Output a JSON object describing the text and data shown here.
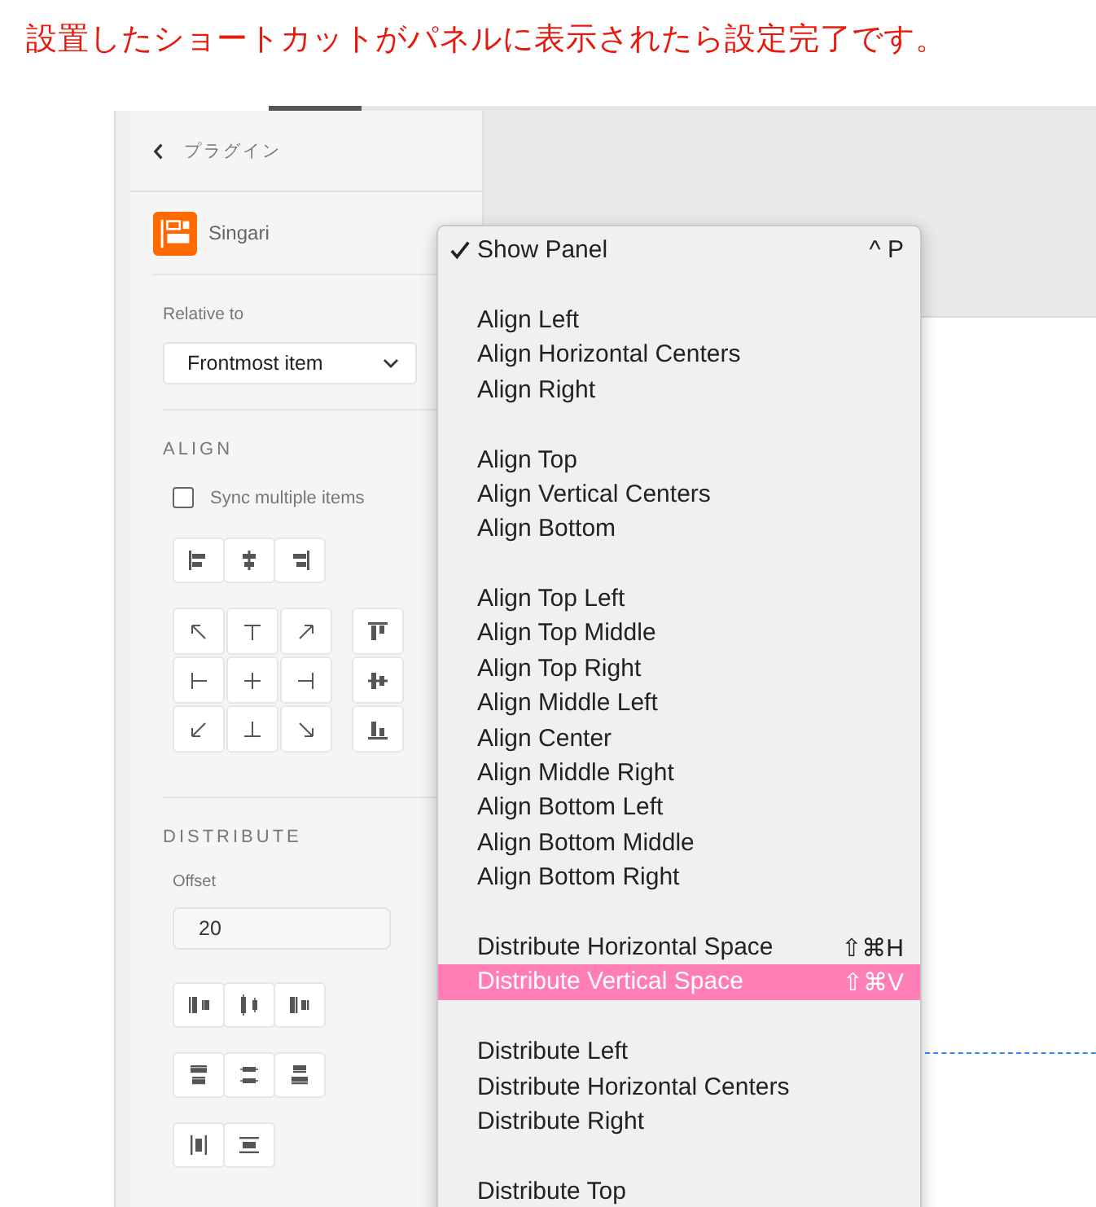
{
  "caption": "設置したショートカットがパネルに表示されたら設定完了です。",
  "panel": {
    "back_label": "プラグイン",
    "plugin_name": "Singari",
    "relative_label": "Relative to",
    "relative_value": "Frontmost item",
    "align_heading": "ALIGN",
    "sync_label": "Sync multiple items",
    "sync_checked": false,
    "distribute_heading": "DISTRIBUTE",
    "offset_label": "Offset",
    "offset_value": "20"
  },
  "menu": {
    "groups": [
      {
        "items": [
          {
            "label": "Show Panel",
            "shortcut": "^ P",
            "checked": true,
            "selected": false
          }
        ]
      },
      {
        "items": [
          {
            "label": "Align Left",
            "checked": false,
            "selected": false
          },
          {
            "label": "Align Horizontal Centers",
            "checked": false,
            "selected": false
          },
          {
            "label": "Align Right",
            "checked": false,
            "selected": false
          }
        ]
      },
      {
        "items": [
          {
            "label": "Align Top",
            "checked": false,
            "selected": false
          },
          {
            "label": "Align Vertical Centers",
            "checked": false,
            "selected": false
          },
          {
            "label": "Align Bottom",
            "checked": false,
            "selected": false
          }
        ]
      },
      {
        "items": [
          {
            "label": "Align Top Left",
            "checked": false,
            "selected": false
          },
          {
            "label": "Align Top Middle",
            "checked": false,
            "selected": false
          },
          {
            "label": "Align Top Right",
            "checked": false,
            "selected": false
          },
          {
            "label": "Align Middle Left",
            "checked": false,
            "selected": false
          },
          {
            "label": "Align Center",
            "checked": false,
            "selected": false
          },
          {
            "label": "Align Middle Right",
            "checked": false,
            "selected": false
          },
          {
            "label": "Align Bottom Left",
            "checked": false,
            "selected": false
          },
          {
            "label": "Align Bottom Middle",
            "checked": false,
            "selected": false
          },
          {
            "label": "Align Bottom Right",
            "checked": false,
            "selected": false
          }
        ]
      },
      {
        "items": [
          {
            "label": "Distribute Horizontal Space",
            "shortcut": "⇧⌘H",
            "checked": false,
            "selected": false
          },
          {
            "label": "Distribute Vertical Space",
            "shortcut": "⇧⌘V",
            "checked": false,
            "selected": true
          }
        ]
      },
      {
        "items": [
          {
            "label": "Distribute Left",
            "checked": false,
            "selected": false
          },
          {
            "label": "Distribute Horizontal Centers",
            "checked": false,
            "selected": false
          },
          {
            "label": "Distribute Right",
            "checked": false,
            "selected": false
          }
        ]
      },
      {
        "items": [
          {
            "label": "Distribute Top",
            "checked": false,
            "selected": false
          }
        ]
      }
    ]
  }
}
